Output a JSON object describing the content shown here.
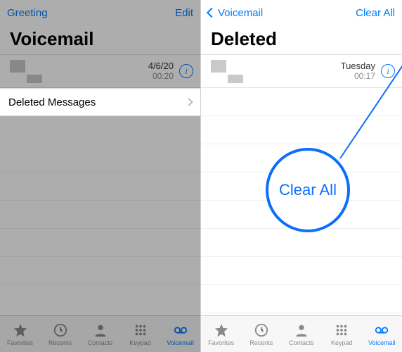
{
  "accent": "#007aff",
  "left": {
    "nav": {
      "left": "Greeting",
      "right": "Edit"
    },
    "title": "Voicemail",
    "row": {
      "date": "4/6/20",
      "duration": "00:20"
    },
    "deleted_label": "Deleted Messages"
  },
  "right": {
    "nav": {
      "back": "Voicemail",
      "right": "Clear All"
    },
    "title": "Deleted",
    "row": {
      "date": "Tuesday",
      "duration": "00:17"
    },
    "callout": "Clear All"
  },
  "tabs": {
    "favorites": "Favorites",
    "recents": "Recents",
    "contacts": "Contacts",
    "keypad": "Keypad",
    "voicemail": "Voicemail"
  }
}
